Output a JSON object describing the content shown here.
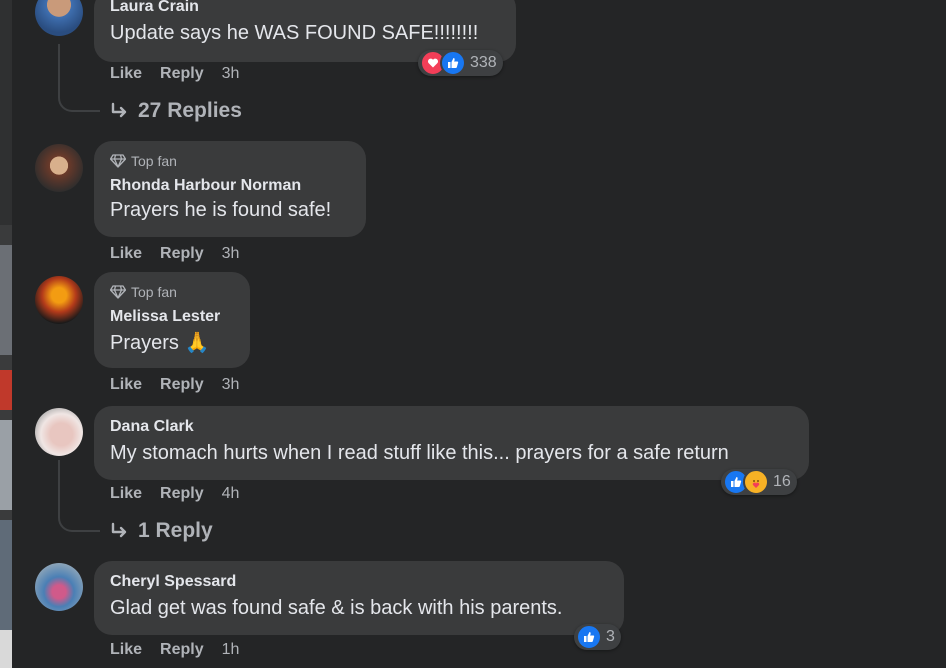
{
  "comments": [
    {
      "author": "Laura Crain",
      "badge": "",
      "text": "Update says he WAS FOUND SAFE!!!!!!!!",
      "like": "Like",
      "reply": "Reply",
      "time": "3h",
      "reaction_count": "338",
      "replies_label": "27 Replies"
    },
    {
      "author": "Rhonda Harbour Norman",
      "badge": "Top fan",
      "text": "Prayers he is found safe!",
      "like": "Like",
      "reply": "Reply",
      "time": "3h"
    },
    {
      "author": "Melissa Lester",
      "badge": "Top fan",
      "text": "Prayers 🙏",
      "like": "Like",
      "reply": "Reply",
      "time": "3h"
    },
    {
      "author": "Dana Clark",
      "badge": "",
      "text": "My stomach hurts when I read stuff like this... prayers for a safe return",
      "like": "Like",
      "reply": "Reply",
      "time": "4h",
      "reaction_count": "16",
      "replies_label": "1 Reply"
    },
    {
      "author": "Cheryl Spessard",
      "badge": "",
      "text": "Glad get was found safe & is back with his parents.",
      "like": "Like",
      "reply": "Reply",
      "time": "1h",
      "reaction_count": "3"
    }
  ],
  "colors": {
    "background": "#242526",
    "bubble": "#3a3b3c",
    "like_blue": "#1877f2",
    "love_red": "#f33e58",
    "care_yellow": "#f7b125"
  }
}
